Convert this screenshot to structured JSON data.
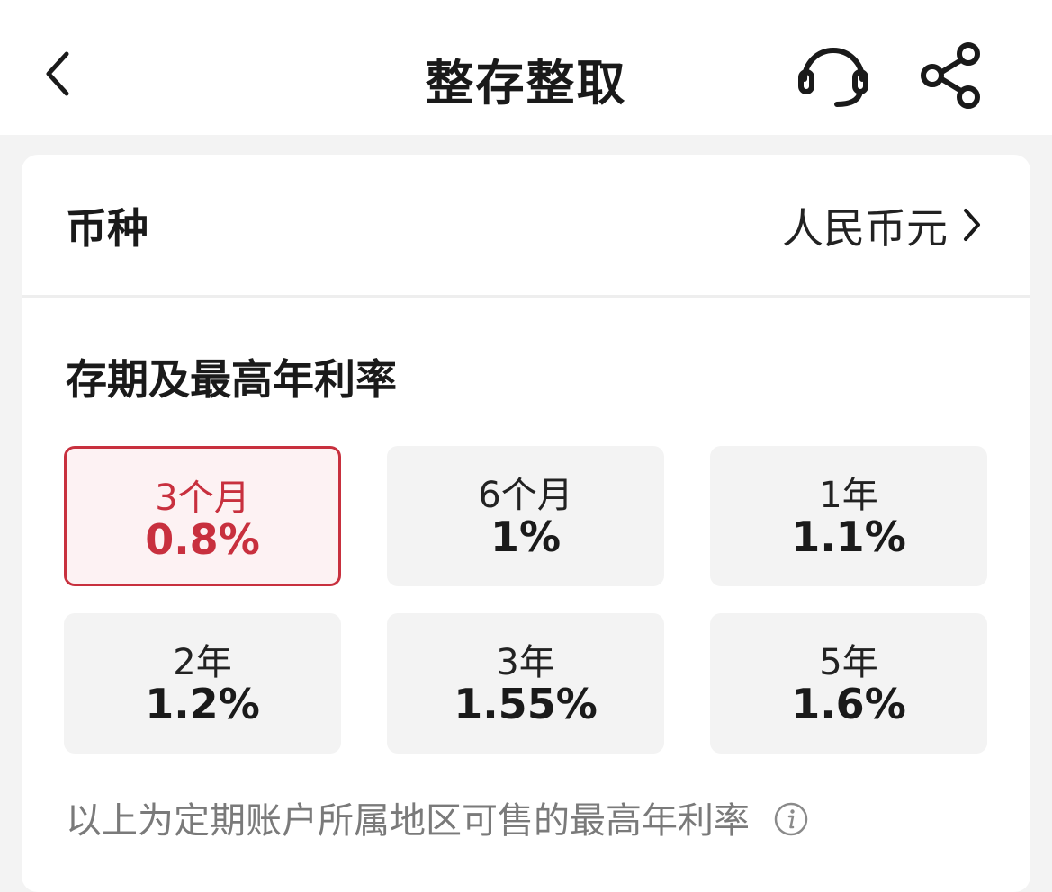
{
  "header": {
    "title": "整存整取"
  },
  "currency": {
    "label": "币种",
    "value": "人民币元"
  },
  "terms_section": {
    "title": "存期及最高年利率",
    "options": [
      {
        "label": "3个月",
        "rate": "0.8%",
        "selected": true
      },
      {
        "label": "6个月",
        "rate": "1%",
        "selected": false
      },
      {
        "label": "1年",
        "rate": "1.1%",
        "selected": false
      },
      {
        "label": "2年",
        "rate": "1.2%",
        "selected": false
      },
      {
        "label": "3年",
        "rate": "1.55%",
        "selected": false
      },
      {
        "label": "5年",
        "rate": "1.6%",
        "selected": false
      }
    ]
  },
  "footnote": "以上为定期账户所属地区可售的最高年利率",
  "icons": {
    "back": "back-icon",
    "service": "headset-icon",
    "share": "share-icon",
    "chevron": "chevron-right-icon",
    "info": "info-icon"
  },
  "colors": {
    "accent": "#c8303e",
    "selected_bg": "#fdf2f3",
    "tile_bg": "#f3f3f3",
    "page_bg": "#f3f3f3",
    "muted_text": "#7a7a7a"
  }
}
